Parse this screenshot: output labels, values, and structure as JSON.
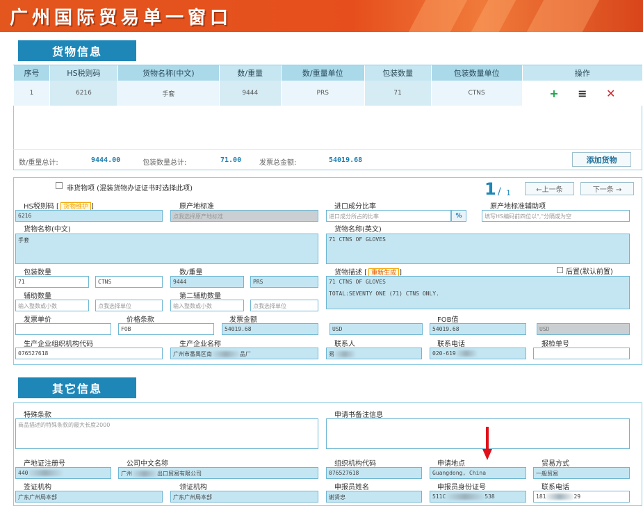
{
  "banner": {
    "title": "广州国际贸易单一窗口"
  },
  "goods_section": {
    "tab": "货物信息",
    "columns": [
      "序号",
      "HS税则码",
      "货物名称(中文)",
      "数/重量",
      "数/重量单位",
      "包装数量",
      "包装数量单位",
      "操作"
    ],
    "rows": [
      {
        "seq": "1",
        "hs": "6216",
        "name_cn": "手套",
        "qty": "9444",
        "qty_unit": "PRS",
        "pkg": "71",
        "pkg_unit": "CTNS"
      }
    ],
    "ops": {
      "add": "+",
      "menu": "≡",
      "delete": "✕"
    }
  },
  "summary": {
    "qty_total_label": "数/重量总计:",
    "qty_total": "9444.00",
    "pkg_total_label": "包装数量总计:",
    "pkg_total": "71.00",
    "invoice_total_label": "发票总金额:",
    "invoice_total": "54019.68",
    "add_button": "添加货物"
  },
  "detail": {
    "non_goods_label": "非货物项 (混装货物办证证书时选择此项)",
    "page_current": "1",
    "page_total": "1",
    "prev_button": "←上一条",
    "next_button": "下一条 →",
    "hs_label": "HS税则码",
    "hs_tag": "货物维护",
    "hs_value": "6216",
    "origin_label": "原产地标准",
    "origin_placeholder": "点我选择原产地标准",
    "import_ratio_label": "进口成分比率",
    "import_ratio_placeholder": "进口成分所占的比率",
    "pct": "%",
    "origin_aux_label": "原产地标准辅助项",
    "origin_aux_placeholder": "填写HS编码前四位以\",\"分隔或为空",
    "name_cn_label": "货物名称(中文)",
    "name_cn_value": "手套",
    "name_en_label": "货物名称(英文)",
    "name_en_value": "71  CTNS OF GLOVES",
    "pkg_qty_label": "包装数量",
    "pkg_qty_value": "71",
    "pkg_unit_value": "CTNS",
    "qty_label": "数/重量",
    "qty_value": "9444",
    "qty_unit_value": "PRS",
    "desc_label": "货物描述",
    "desc_tag": "重新生成",
    "postfix_label": "后置(默认前置)",
    "desc_line1": "71  CTNS OF GLOVES",
    "desc_line2": "TOTAL:SEVENTY ONE (71) CTNS ONLY.",
    "aux_qty_label": "辅助数量",
    "aux_qty_placeholder": "输入整数或小数",
    "aux_unit_placeholder": "点我选择单位",
    "aux2_label": "第二辅助数量",
    "aux2_qty_placeholder": "输入整数或小数",
    "aux2_unit_placeholder": "点我选择单位",
    "invoice_unit_label": "发票单价",
    "price_terms_label": "价格条款",
    "price_terms_value": "FOB",
    "invoice_amount_label": "发票金额",
    "invoice_amount_value": "54019.68",
    "currency_value": "USD",
    "fob_label": "FOB值",
    "fob_value": "54019.68",
    "fob_currency_value": "USD",
    "org_code_label": "生产企业组织机构代码",
    "org_code_value": "076527618",
    "producer_label": "生产企业名称",
    "producer_value_a": "广州市番禺区南",
    "producer_value_b": "品厂",
    "contact_label": "联系人",
    "contact_value": "易",
    "phone_label": "联系电话",
    "phone_value": "020-619",
    "inspection_label": "报检单号"
  },
  "other_section": {
    "tab": "其它信息",
    "special_label": "特殊条款",
    "special_placeholder": "商品描述的特殊条款的最大长度2000",
    "remark_label": "申请书备注信息",
    "reg_no_label": "产地证注册号",
    "reg_no_value": "440",
    "company_cn_label": "公司中文名称",
    "company_cn_value_a": "广州",
    "company_cn_value_b": "出口贸易有限公司",
    "org_code_label": "组织机构代码",
    "org_code_value": "076527618",
    "apply_place_label": "申请地点",
    "apply_place_value": "Guangdong, China",
    "trade_mode_label": "贸易方式",
    "trade_mode_value": "一般贸易",
    "visa_org_label": "签证机构",
    "visa_org_value": "广东广州局本部",
    "collect_org_label": "领证机构",
    "collect_org_value": "广东广州局本部",
    "declarant_label": "申报员姓名",
    "declarant_value": "谢贤忠",
    "declarant_id_label": "申报员身份证号",
    "declarant_id_value_a": "511C",
    "declarant_id_value_b": "538",
    "contact_phone_label": "联系电话",
    "contact_phone_value_a": "181",
    "contact_phone_value_b": "29"
  },
  "colors": {
    "banner": "#e3561d",
    "section_tab": "#1e87b8",
    "field_blue": "#c4e6f3",
    "arrow": "#e0101a"
  }
}
